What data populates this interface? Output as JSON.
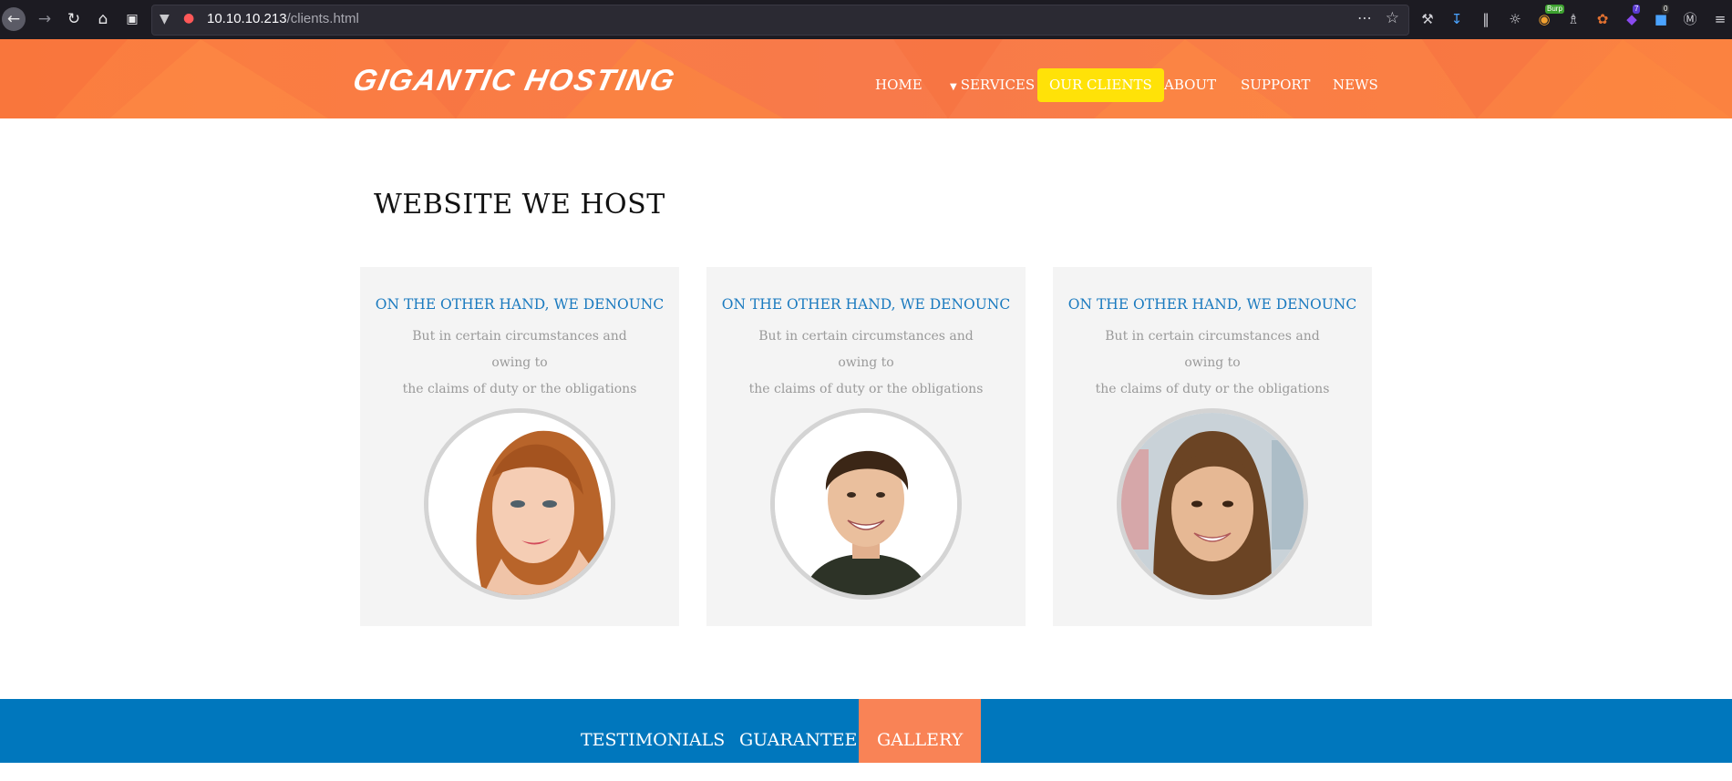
{
  "browser": {
    "url_host": "10.10.10.213",
    "url_path": "/clients.html",
    "toolbar_badges": {
      "burp": "Burp",
      "ext_count_1": "7",
      "ext_count_2": "0"
    }
  },
  "header": {
    "logo_text": "GIGANTIC HOSTING",
    "nav": [
      {
        "label": "HOME"
      },
      {
        "label": "SERVICES"
      },
      {
        "label": "OUR CLIENTS"
      },
      {
        "label": "ABOUT"
      },
      {
        "label": "SUPPORT"
      },
      {
        "label": "NEWS"
      }
    ],
    "active_color": "#ffe208",
    "header_color": "#fb7e3e"
  },
  "main": {
    "title": "WEBSITE WE HOST",
    "cards": [
      {
        "heading": "ON THE OTHER HAND, WE DENOUNC",
        "line1": "But in certain circumstances and owing to",
        "line2": "the claims of duty or the obligations"
      },
      {
        "heading": "ON THE OTHER HAND, WE DENOUNC",
        "line1": "But in certain circumstances and owing to",
        "line2": "the claims of duty or the obligations"
      },
      {
        "heading": "ON THE OTHER HAND, WE DENOUNC",
        "line1": "But in certain circumstances and owing to",
        "line2": "the claims of duty or the obligations"
      }
    ]
  },
  "footer_tabs": {
    "items": [
      {
        "label": "TESTIMONIALS"
      },
      {
        "label": "GUARANTEE"
      },
      {
        "label": "GALLERY"
      }
    ],
    "bar_color": "#0077bd",
    "active_color": "#f98356"
  }
}
